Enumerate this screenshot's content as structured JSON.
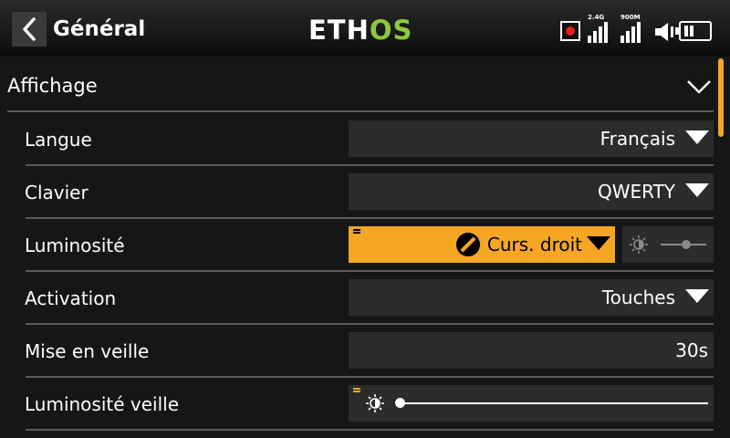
{
  "header": {
    "title": "Général",
    "logo_main": "ETH",
    "logo_accent": "OS",
    "rf_modules": [
      {
        "label": "2.4G",
        "bars": 4
      },
      {
        "label": "900M",
        "bars": 4
      }
    ],
    "battery_cells": 2
  },
  "section": {
    "label": "Affichage"
  },
  "settings": {
    "language": {
      "label": "Langue",
      "value": "Français"
    },
    "keyboard": {
      "label": "Clavier",
      "value": "QWERTY"
    },
    "brightness": {
      "label": "Luminosité",
      "value": "Curs. droit",
      "slider_level": 0.55
    },
    "activation": {
      "label": "Activation",
      "value": "Touches"
    },
    "sleep": {
      "label": "Mise en veille",
      "value": "30s"
    },
    "sleep_brightness": {
      "label": "Luminosité veille",
      "slider_level": 0.0
    }
  },
  "colors": {
    "accent": "#f5a623",
    "logo_green": "#8dc63f",
    "record": "#e0201c",
    "background": "#161616",
    "field": "#2c2c2c"
  },
  "icons": [
    "back-chevron-icon",
    "record-icon",
    "signal-icon",
    "speaker-icon",
    "battery-icon",
    "chevron-down-icon",
    "brightness-icon",
    "right-slider-icon",
    "caret-down-icon"
  ]
}
